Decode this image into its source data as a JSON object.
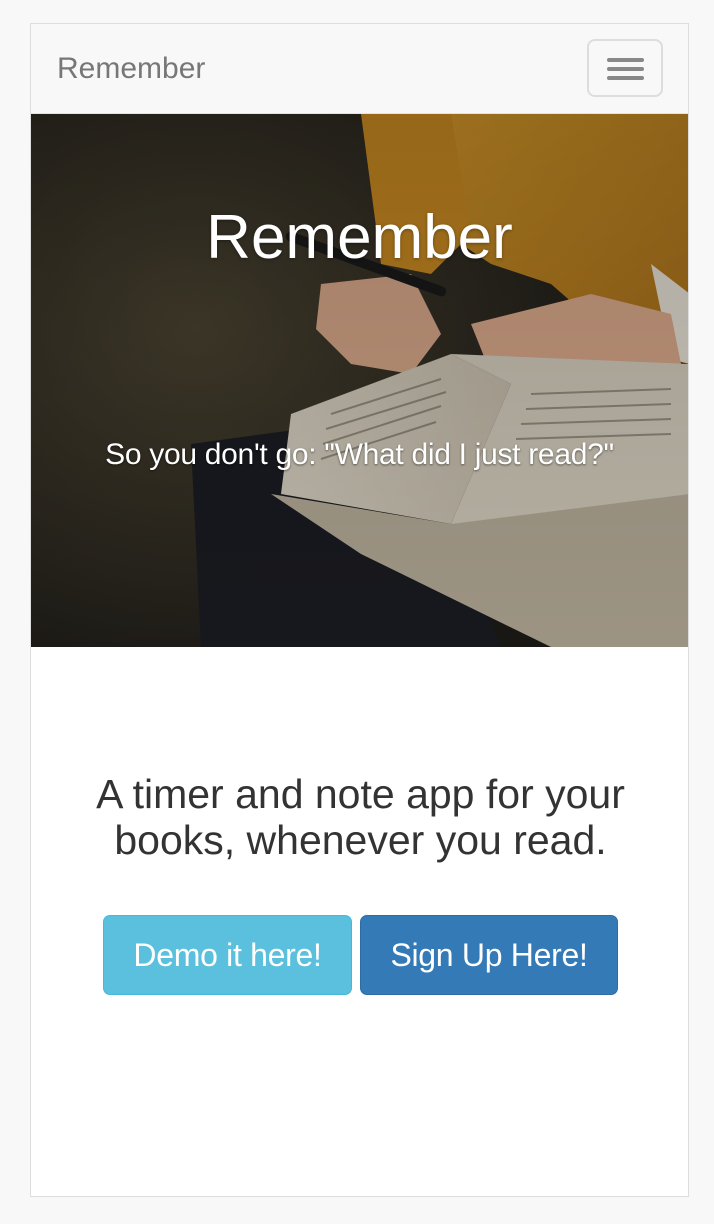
{
  "navbar": {
    "brand": "Remember",
    "menu_icon": "hamburger-menu-icon"
  },
  "hero": {
    "title": "Remember",
    "subtitle": "So you don't go: \"What did I just read?\"",
    "background": "photo-person-writing-in-open-book"
  },
  "main": {
    "tagline": "A timer and note app for your books, whenever you read.",
    "demo_button": "Demo it here!",
    "signup_button": "Sign Up Here!"
  },
  "colors": {
    "demo_button": "#5bc0de",
    "signup_button": "#337ab7",
    "navbar_bg": "#f8f8f8",
    "text": "#333333"
  }
}
